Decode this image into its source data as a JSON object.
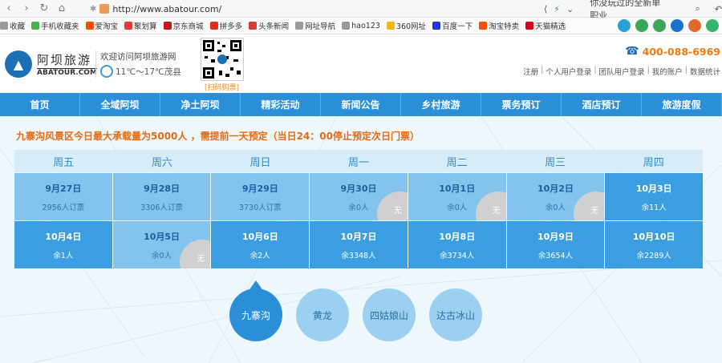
{
  "browser": {
    "url": "http://www.abatour.com/",
    "suggestion": "你没玩过的全新单职业"
  },
  "bookmarks": [
    {
      "label": "收藏",
      "color": "#999999"
    },
    {
      "label": "手机收藏夹",
      "color": "#4caf50"
    },
    {
      "label": "爱淘宝",
      "color": "#ff5000"
    },
    {
      "label": "聚划算",
      "color": "#e4393c"
    },
    {
      "label": "京东商城",
      "color": "#c81623"
    },
    {
      "label": "拼多多",
      "color": "#e02e24"
    },
    {
      "label": "头条新闻",
      "color": "#d43d3d"
    },
    {
      "label": "网址导航",
      "color": "#999999"
    },
    {
      "label": "hao123",
      "color": "#999999"
    },
    {
      "label": "360网址",
      "color": "#f5b700"
    },
    {
      "label": "百度一下",
      "color": "#2932e1"
    },
    {
      "label": "淘宝特卖",
      "color": "#ff5000"
    },
    {
      "label": "天猫精选",
      "color": "#d9001b"
    }
  ],
  "header": {
    "logo_cn": "阿坝旅游",
    "logo_en": "ABATOUR.COM",
    "welcome": "欢迎访问阿坝旅游网",
    "weather": "11℃～17℃茂县",
    "qr_label": "[扫码购票]",
    "hotline": "400-088-6969",
    "user_links": [
      "注册",
      "个人用户登录",
      "团队用户登录",
      "我的账户",
      "数据统计"
    ]
  },
  "nav": [
    "首页",
    "全域阿坝",
    "净土阿坝",
    "精彩活动",
    "新闻公告",
    "乡村旅游",
    "票务预订",
    "酒店预订",
    "旅游度假"
  ],
  "notice": "九寨沟风景区今日最大承载量为5000人 ，需提前一天预定（当日24：00停止预定次日门票）",
  "calendar": {
    "weekdays": [
      "周五",
      "周六",
      "周日",
      "周一",
      "周二",
      "周三",
      "周四"
    ],
    "rows": [
      [
        {
          "date": "9月27日",
          "info": "2956人订票",
          "style": "light",
          "soldout": false
        },
        {
          "date": "9月28日",
          "info": "3306人订票",
          "style": "light",
          "soldout": false
        },
        {
          "date": "9月29日",
          "info": "3730人订票",
          "style": "light",
          "soldout": false
        },
        {
          "date": "9月30日",
          "info": "余0人",
          "style": "light",
          "soldout": true
        },
        {
          "date": "10月1日",
          "info": "余0人",
          "style": "light",
          "soldout": true
        },
        {
          "date": "10月2日",
          "info": "余0人",
          "style": "light",
          "soldout": true
        },
        {
          "date": "10月3日",
          "info": "余11人",
          "style": "dark",
          "soldout": false
        }
      ],
      [
        {
          "date": "10月4日",
          "info": "余1人",
          "style": "dark",
          "soldout": false
        },
        {
          "date": "10月5日",
          "info": "余0人",
          "style": "light",
          "soldout": true
        },
        {
          "date": "10月6日",
          "info": "余2人",
          "style": "dark",
          "soldout": false
        },
        {
          "date": "10月7日",
          "info": "余3348人",
          "style": "dark",
          "soldout": false
        },
        {
          "date": "10月8日",
          "info": "余3734人",
          "style": "dark",
          "soldout": false
        },
        {
          "date": "10月9日",
          "info": "余3654人",
          "style": "dark",
          "soldout": false
        },
        {
          "date": "10月10日",
          "info": "余2289人",
          "style": "dark",
          "soldout": false
        }
      ]
    ],
    "soldout_label": "无"
  },
  "spots": [
    {
      "label": "九寨沟",
      "active": true
    },
    {
      "label": "黄龙",
      "active": false
    },
    {
      "label": "四姑娘山",
      "active": false
    },
    {
      "label": "达古冰山",
      "active": false
    }
  ]
}
